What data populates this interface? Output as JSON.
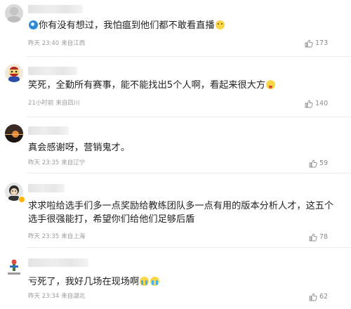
{
  "comments": [
    {
      "text": "你有没有想过，我怕瘟到他们都不敢看直播",
      "time": "昨天 23:40",
      "location": "来自江西",
      "likes": "173",
      "lead_emoji": "blue-snail-emoji",
      "trail_emoji": "smile-emoji"
    },
    {
      "text": "笑死，全勤所有赛事，能不能找出5个人啊，看起来很大方",
      "time": "21小时前",
      "location": "来自四川",
      "likes": "140",
      "trail_emoji": "tongue-out-emoji"
    },
    {
      "text": "真会感谢呀，营销鬼才。",
      "time": "昨天 23:35",
      "location": "来自辽宁",
      "likes": "59"
    },
    {
      "line1": "求求啦给选手们多一点奖励给教练团队多一点有用的版本分析人才，这五个",
      "line2": "选手很强能打，希望你们给他们足够后盾",
      "time": "昨天 23:35",
      "location": "来自上海",
      "likes": "78"
    },
    {
      "text": "亏死了，我好几场在现场啊",
      "time": "昨天 23:34",
      "location": "来自湖北",
      "likes": "62",
      "trail_emoji": "crying-emoji"
    }
  ],
  "colors": {
    "text": "#1f1f1f",
    "meta": "#9b9b9b",
    "divider": "#ededed",
    "verified": "#ffb400"
  }
}
